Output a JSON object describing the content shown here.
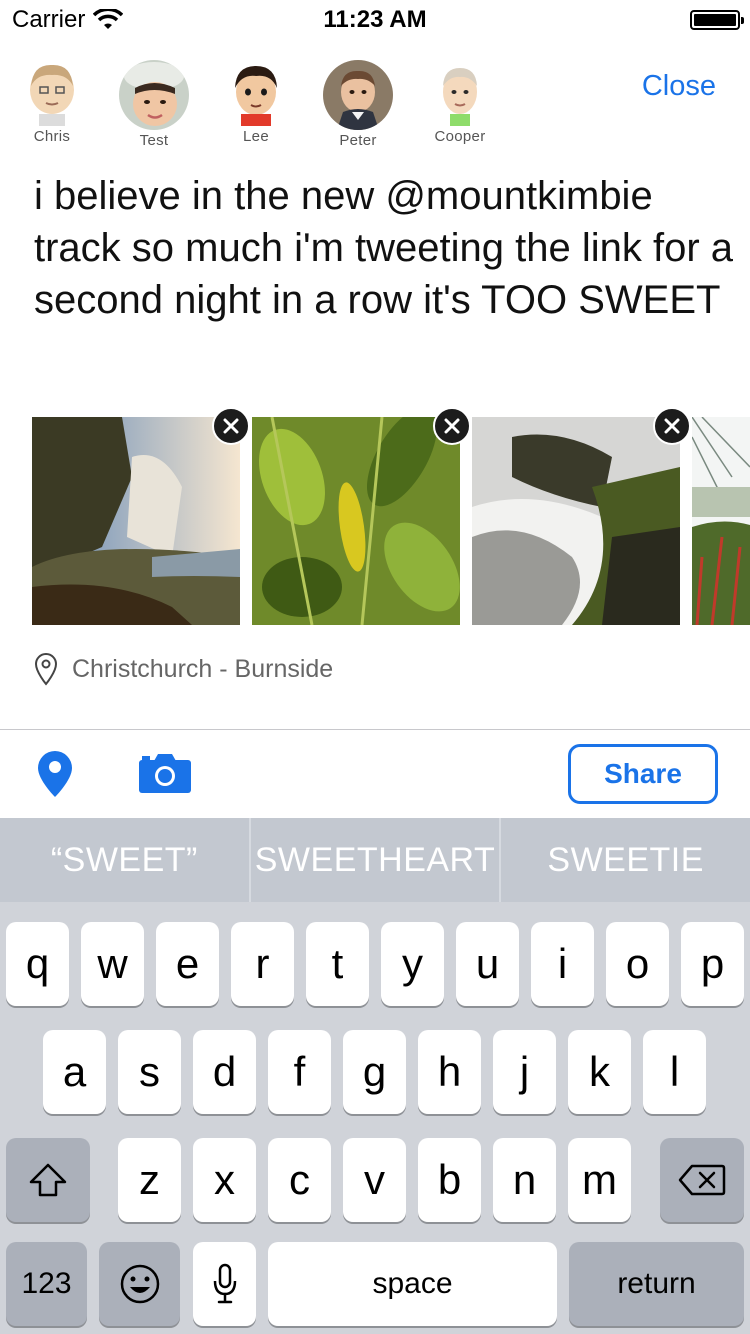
{
  "status_bar": {
    "carrier": "Carrier",
    "time": "11:23 AM"
  },
  "contacts": [
    {
      "name": "Chris",
      "avatar": "mii-avatar"
    },
    {
      "name": "Test",
      "avatar": "child-photo"
    },
    {
      "name": "Lee",
      "avatar": "cartoon-avatar"
    },
    {
      "name": "Peter",
      "avatar": "toddler-photo"
    },
    {
      "name": "Cooper",
      "avatar": "mii-avatar"
    }
  ],
  "header": {
    "close_label": "Close"
  },
  "tweet": {
    "text": "i believe in the new @mountkimbie track so much i'm tweeting the link for a second night in a row it's TOO SWEET"
  },
  "photos": [
    {
      "subject": "waterfall-cliff"
    },
    {
      "subject": "green-leaves"
    },
    {
      "subject": "stream-rocks"
    },
    {
      "subject": "grass-partial"
    }
  ],
  "location": {
    "text": "Christchurch - Burnside",
    "icon": "map-pin-outline-icon"
  },
  "toolbar": {
    "share_label": "Share",
    "accent": "#1a73e8"
  },
  "keyboard": {
    "suggestions": [
      "“SWEET”",
      "SWEETHEART",
      "SWEETIE"
    ],
    "row1": [
      "q",
      "w",
      "e",
      "r",
      "t",
      "y",
      "u",
      "i",
      "o",
      "p"
    ],
    "row2": [
      "a",
      "s",
      "d",
      "f",
      "g",
      "h",
      "j",
      "k",
      "l"
    ],
    "row3": [
      "z",
      "x",
      "c",
      "v",
      "b",
      "n",
      "m"
    ],
    "numbers_label": "123",
    "space_label": "space",
    "return_label": "return"
  }
}
